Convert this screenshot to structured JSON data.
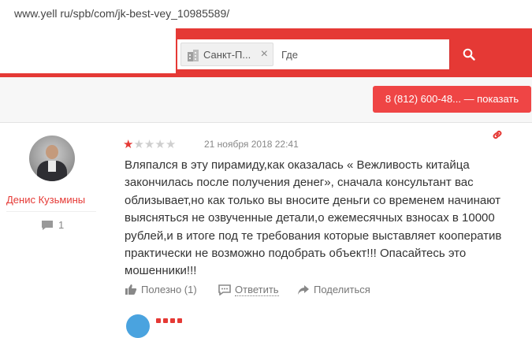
{
  "browser": {
    "url": "www.yell ru/spb/com/jk-best-vey_10985589/"
  },
  "search": {
    "city_chip": "Санкт-П...",
    "city_close": "×",
    "where_placeholder": "Где",
    "button_icon": "search-icon"
  },
  "phone_button": {
    "label": "8 (812) 600-48... — показать"
  },
  "review": {
    "user": {
      "name": "Денис Кузьмины",
      "comment_count": "1"
    },
    "rating": {
      "value": 1,
      "max": 5
    },
    "date": "21 ноября 2018 22:41",
    "text": "Вляпался в эту пирамиду,как оказалась « Вежливость китайца закончилась после получения денег», сначала консультант вас облизывает,но как только вы вносите деньги со временем начинают выясняться не озвученные детали,о ежемесячных взносах в 10000 рублей,и в итоге под те требования которые выставляет кооператив практически не возможно подобрать объект!!! Опасайтесь это мошенники!!!",
    "actions": {
      "helpful": "Полезно (1)",
      "reply": "Ответить",
      "share": "Поделиться"
    }
  },
  "colors": {
    "brand_red": "#e53935",
    "button_red": "#ef4545"
  }
}
